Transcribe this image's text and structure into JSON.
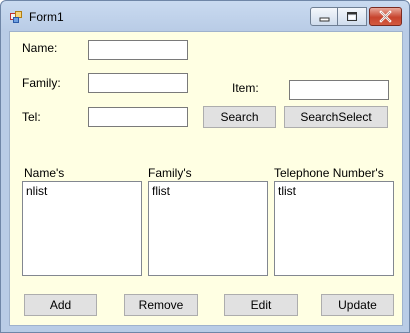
{
  "window": {
    "title": "Form1",
    "icons": {
      "app": "form-icon",
      "minimize": "minimize-icon",
      "maximize": "maximize-icon",
      "close": "close-icon"
    }
  },
  "form": {
    "name_label": "Name:",
    "family_label": "Family:",
    "tel_label": "Tel:",
    "item_label": "Item:",
    "name_value": "",
    "family_value": "",
    "tel_value": "",
    "item_value": ""
  },
  "buttons": {
    "search": "Search",
    "search_select": "SearchSelect",
    "add": "Add",
    "remove": "Remove",
    "edit": "Edit",
    "update": "Update"
  },
  "lists": {
    "names": {
      "header": "Name's",
      "items": [
        "nlist"
      ]
    },
    "families": {
      "header": "Family's",
      "items": [
        "flist"
      ]
    },
    "phones": {
      "header": "Telephone Number's",
      "items": [
        "tlist"
      ]
    }
  },
  "colors": {
    "client_background": "#ffffe3",
    "title_background": "#c9daf0",
    "close_button": "#c7442e"
  }
}
